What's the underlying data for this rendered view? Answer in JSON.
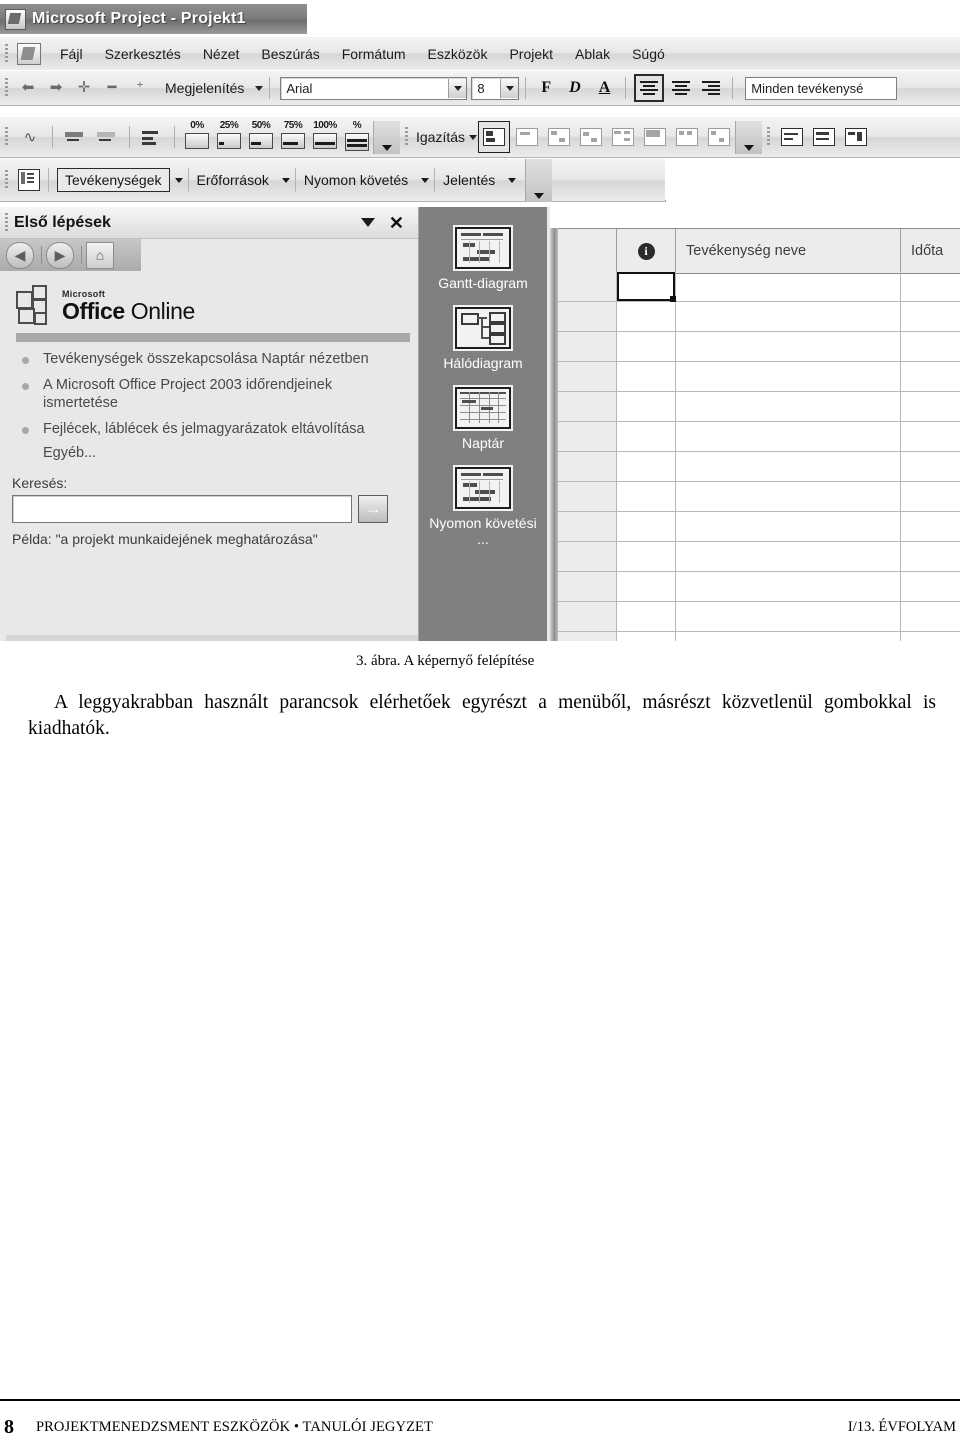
{
  "window": {
    "title": "Microsoft Project - Projekt1",
    "app_icon": "project-app-icon"
  },
  "menubar": {
    "items": [
      {
        "label": "Fájl",
        "accel": "F"
      },
      {
        "label": "Szerkesztés",
        "accel": "z"
      },
      {
        "label": "Nézet",
        "accel": "N"
      },
      {
        "label": "Beszúrás",
        "accel": "B"
      },
      {
        "label": "Formátum",
        "accel": "t"
      },
      {
        "label": "Eszközök",
        "accel": "z"
      },
      {
        "label": "Projekt",
        "accel": "P"
      },
      {
        "label": "Ablak",
        "accel": "A"
      },
      {
        "label": "Súgó",
        "accel": "S"
      }
    ]
  },
  "formatting_toolbar": {
    "outdent_label": "outdent",
    "indent_label": "indent",
    "show_button": "Megjelenítés",
    "font_name": "Arial",
    "font_size": "8",
    "bold_label": "F",
    "italic_label": "D",
    "underline_label": "A",
    "align_left": "align-left",
    "align_center": "align-center",
    "align_right": "align-right",
    "filter_value": "Minden tevékenysé"
  },
  "tracking_toolbar": {
    "percent_buttons": [
      "0%",
      "25%",
      "50%",
      "75%",
      "100%"
    ],
    "align_button": "Igazítás"
  },
  "view_toolbar": {
    "buttons": [
      "Tevékenységek",
      "Erőforrások",
      "Nyomon követés",
      "Jelentés"
    ],
    "selected": "Tevékenységek"
  },
  "task_pane": {
    "title": "Első lépések",
    "close_label": "✕",
    "nav": {
      "back": "back-arrow",
      "forward": "forward-arrow",
      "home": "home"
    },
    "logo": {
      "microsoft": "Microsoft",
      "office": "Office",
      "online": "Online"
    },
    "links": [
      "Tevékenységek összekapcsolása Naptár nézetben",
      "A Microsoft Office Project 2003 időrendjeinek ismertetése",
      "Fejlécek, láblécek és jelmagyarázatok eltávolítása"
    ],
    "more_label": "Egyéb...",
    "search_label": "Keresés:",
    "search_value": "",
    "search_placeholder": "",
    "go_label": "→",
    "example_label": "Példa:  \"a projekt munkaidejének meghatározása\""
  },
  "view_bar": {
    "items": [
      {
        "label": "Gantt-diagram",
        "icon": "gantt-chart-icon"
      },
      {
        "label": "Hálódiagram",
        "icon": "network-diagram-icon"
      },
      {
        "label": "Naptár",
        "icon": "calendar-icon"
      },
      {
        "label": "Nyomon követési ...",
        "icon": "tracking-gantt-icon"
      }
    ]
  },
  "sheet": {
    "columns": [
      "",
      "info",
      "Tevékenység neve",
      "Időta"
    ],
    "info_icon": "info-icon",
    "row_count": 13,
    "selected_cell": {
      "row": 1,
      "column": "info"
    }
  },
  "document": {
    "figure_caption": "3. ábra. A képernyő felépítése",
    "body_paragraph": "A leggyakrabban használt parancsok elérhetőek egyrészt a menüből, másrészt közvetlenül gombokkal is kiadhatók.",
    "footer": {
      "page_number": "8",
      "left_text": "PROJEKTMENEDZSMENT ESZKÖZÖK • TANULÓI JEGYZET",
      "right_text": "I/13. ÉVFOLYAM"
    }
  },
  "colors": {
    "titlebar": "#7d7d7d",
    "toolbar": "#e7e7e7",
    "viewstrip": "#808080",
    "header_cell": "#ececec"
  }
}
